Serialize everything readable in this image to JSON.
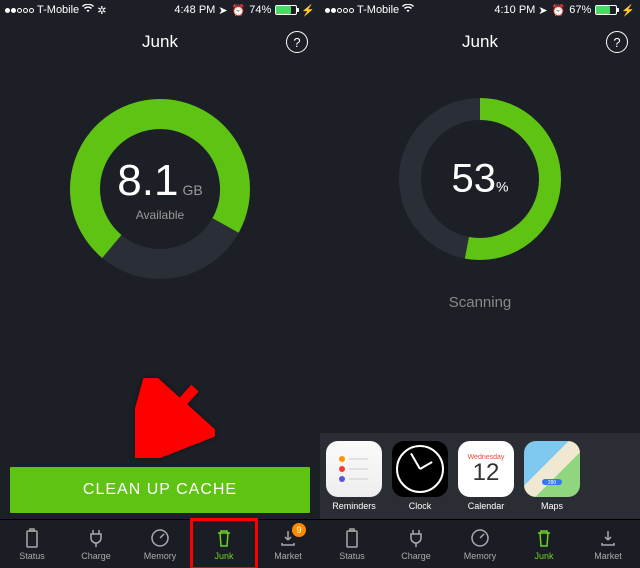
{
  "left": {
    "status": {
      "carrier": "T-Mobile",
      "time": "4:48 PM",
      "battery": "74%",
      "batteryFill": 74
    },
    "title": "Junk",
    "ring": {
      "value": "8.1",
      "unit": "GB",
      "sub": "Available",
      "pct": 72
    },
    "cta": "CLEAN UP CACHE",
    "tabs": [
      {
        "label": "Status",
        "active": false
      },
      {
        "label": "Charge",
        "active": false
      },
      {
        "label": "Memory",
        "active": false
      },
      {
        "label": "Junk",
        "active": true,
        "highlight": true
      },
      {
        "label": "Market",
        "active": false,
        "badge": "9"
      }
    ]
  },
  "right": {
    "status": {
      "carrier": "T-Mobile",
      "time": "4:10 PM",
      "battery": "67%",
      "batteryFill": 67
    },
    "title": "Junk",
    "ring": {
      "value": "53",
      "unit": "%",
      "pct": 53
    },
    "scanning": "Scanning",
    "apps": [
      {
        "name": "Reminders"
      },
      {
        "name": "Clock"
      },
      {
        "name": "Calendar",
        "day": "Wednesday",
        "num": "12",
        "highlight": true
      },
      {
        "name": "Maps"
      }
    ],
    "tabs": [
      {
        "label": "Status",
        "active": false
      },
      {
        "label": "Charge",
        "active": false
      },
      {
        "label": "Memory",
        "active": false
      },
      {
        "label": "Junk",
        "active": true
      },
      {
        "label": "Market",
        "active": false
      }
    ]
  }
}
